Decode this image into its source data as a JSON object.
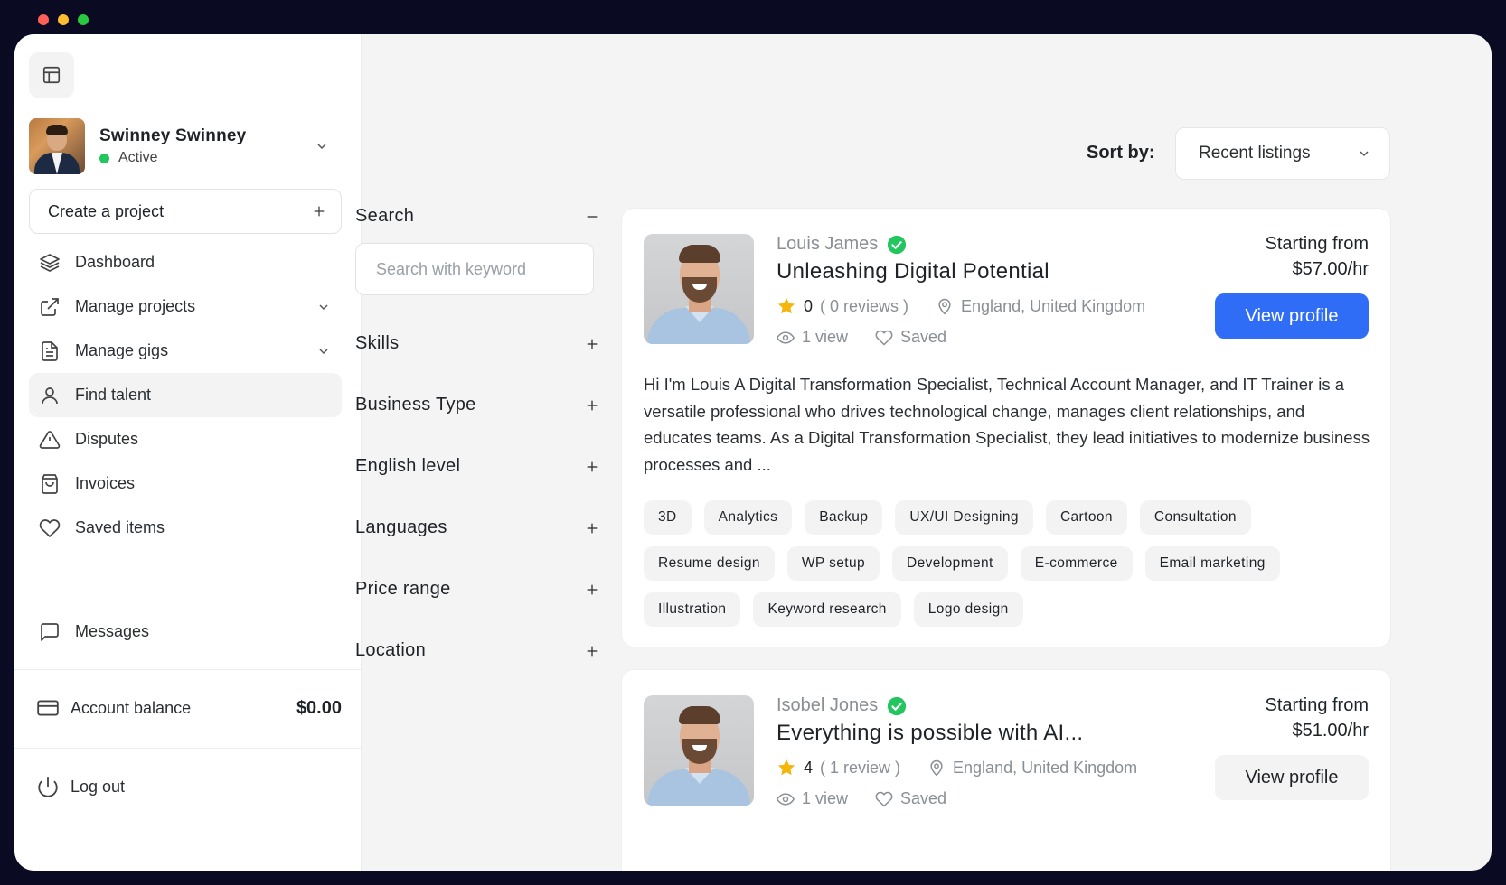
{
  "profile": {
    "name": "Swinney Swinney",
    "status": "Active"
  },
  "sidebar": {
    "create_project": "Create a project",
    "items": [
      {
        "label": "Dashboard",
        "icon": "layers-icon"
      },
      {
        "label": "Manage projects",
        "icon": "external-link-icon",
        "expandable": true
      },
      {
        "label": "Manage gigs",
        "icon": "document-icon",
        "expandable": true
      },
      {
        "label": "Find talent",
        "icon": "user-icon",
        "active": true
      },
      {
        "label": "Disputes",
        "icon": "warning-icon"
      },
      {
        "label": "Invoices",
        "icon": "shopping-bag-icon"
      },
      {
        "label": "Saved items",
        "icon": "heart-icon"
      }
    ],
    "messages": "Messages",
    "account_balance_label": "Account balance",
    "account_balance_value": "$0.00",
    "logout": "Log out"
  },
  "sort": {
    "label": "Sort by:",
    "selected": "Recent listings"
  },
  "filters": {
    "search_title": "Search",
    "search_placeholder": "Search with keyword",
    "groups": [
      "Skills",
      "Business Type",
      "English level",
      "Languages",
      "Price range",
      "Location"
    ]
  },
  "listings": [
    {
      "name": "Louis James",
      "title": "Unleashing Digital Potential",
      "rating": "0",
      "reviews": "( 0 reviews )",
      "location": "England, United Kingdom",
      "views": "1 view",
      "saved": "Saved",
      "price_label": "Starting from",
      "price": "$57.00/hr",
      "button": "View profile",
      "description": "Hi I'm Louis A Digital Transformation Specialist, Technical Account Manager, and IT Trainer is a versatile professional who drives technological change, manages client relationships, and educates teams. As a Digital Transformation Specialist, they lead initiatives to modernize business processes and ...",
      "tags": [
        "3D",
        "Analytics",
        "Backup",
        "UX/UI Designing",
        "Cartoon",
        "Consultation",
        "Resume design",
        "WP setup",
        "Development",
        "E-commerce",
        "Email marketing",
        "Illustration",
        "Keyword research",
        "Logo design"
      ]
    },
    {
      "name": "Isobel Jones",
      "title": "Everything is possible with AI...",
      "rating": "4",
      "reviews": "( 1 review )",
      "location": "England, United Kingdom",
      "views": "1 view",
      "saved": "Saved",
      "price_label": "Starting from",
      "price": "$51.00/hr",
      "button": "View profile"
    }
  ],
  "colors": {
    "accent": "#2f6df6",
    "active_status": "#22c55e",
    "star": "#f5b50a"
  }
}
